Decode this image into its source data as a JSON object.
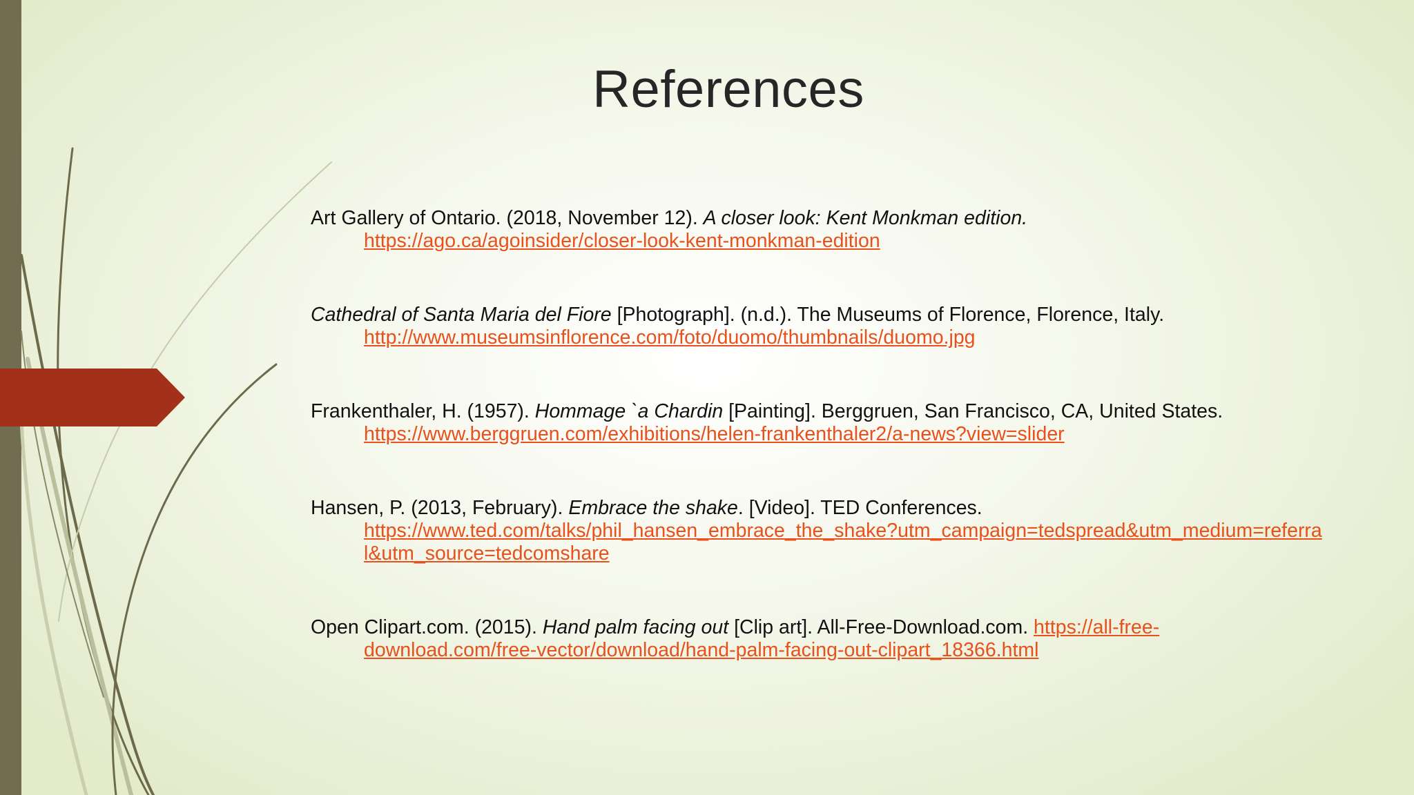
{
  "slide": {
    "title": "References",
    "accent_color": "#a3311a",
    "bar_color": "#726c51",
    "link_color": "#e8501c"
  },
  "references": [
    {
      "author": "Art Gallery of Ontario. (2018, November 12). ",
      "title": "A closer look: Kent Monkman edition.",
      "after": " ",
      "link": "https://ago.ca/agoinsider/closer-look-kent-monkman-edition"
    },
    {
      "author": "",
      "title": "Cathedral of Santa Maria del Fiore",
      "after": " [Photograph]. (n.d.). The Museums of Florence, Florence, Italy. ",
      "link": "http://www.museumsinflorence.com/foto/duomo/thumbnails/duomo.jpg"
    },
    {
      "author": "Frankenthaler, H. (1957). ",
      "title": "Hommage `a Chardin",
      "after": " [Painting]. Berggruen, San Francisco, CA, United States. ",
      "link": "https://www.berggruen.com/exhibitions/helen-frankenthaler2/a-news?view=slider"
    },
    {
      "author": "Hansen, P. (2013, February). ",
      "title": "Embrace the shake",
      "after": ". [Video]. TED Conferences. ",
      "link": "https://www.ted.com/talks/phil_hansen_embrace_the_shake?utm_campaign=tedspread&utm_medium=referral&utm_source=tedcomshare"
    },
    {
      "author": "Open Clipart.com. (2015). ",
      "title": "Hand palm facing out",
      "after": " [Clip art]. All-Free-Download.com. ",
      "link": "https://all-free-download.com/free-vector/download/hand-palm-facing-out-clipart_18366.html"
    }
  ]
}
